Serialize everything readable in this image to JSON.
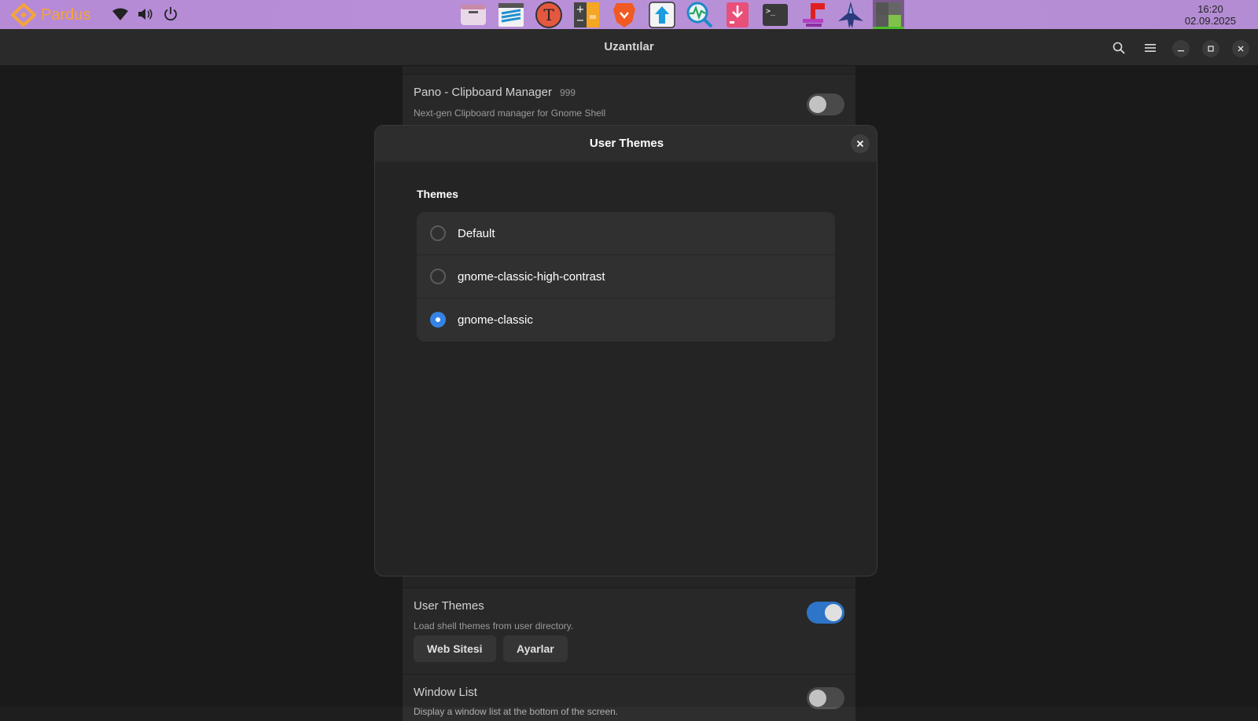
{
  "topbar": {
    "brand": "Pardus",
    "clock_time": "16:20",
    "clock_date": "02.09.2025",
    "tray_icons": [
      "wifi-icon",
      "volume-icon",
      "power-icon"
    ],
    "dock_icons": [
      "files-icon",
      "archive-icon",
      "font-manager-icon",
      "calculator-icon",
      "brave-icon",
      "uploader-icon",
      "system-monitor-icon",
      "package-installer-icon",
      "terminal-icon",
      "tool-icon",
      "rocket-icon",
      "extensions-icon"
    ]
  },
  "window": {
    "title": "Uzantılar",
    "header_icons": [
      "search-icon",
      "menu-icon",
      "minimize-icon",
      "maximize-icon",
      "close-icon"
    ]
  },
  "extensions": [
    {
      "name": "Pano - Clipboard Manager",
      "version": "999",
      "description": "Next-gen Clipboard manager for Gnome Shell",
      "enabled": false
    },
    {
      "name": "User Themes",
      "version": "",
      "description": "Load shell themes from user directory.",
      "enabled": true,
      "btn_website": "Web Sitesi",
      "btn_settings": "Ayarlar"
    },
    {
      "name": "Window List",
      "version": "",
      "description": "Display a window list at the bottom of the screen.",
      "enabled": false
    }
  ],
  "dialog": {
    "title": "User Themes",
    "section_title": "Themes",
    "themes": [
      {
        "label": "Default",
        "selected": false
      },
      {
        "label": "gnome-classic-high-contrast",
        "selected": false
      },
      {
        "label": "gnome-classic",
        "selected": true
      }
    ]
  },
  "colors": {
    "accent": "#3584e4",
    "topbar": "#b68ad6",
    "brand": "#f5a43c"
  }
}
